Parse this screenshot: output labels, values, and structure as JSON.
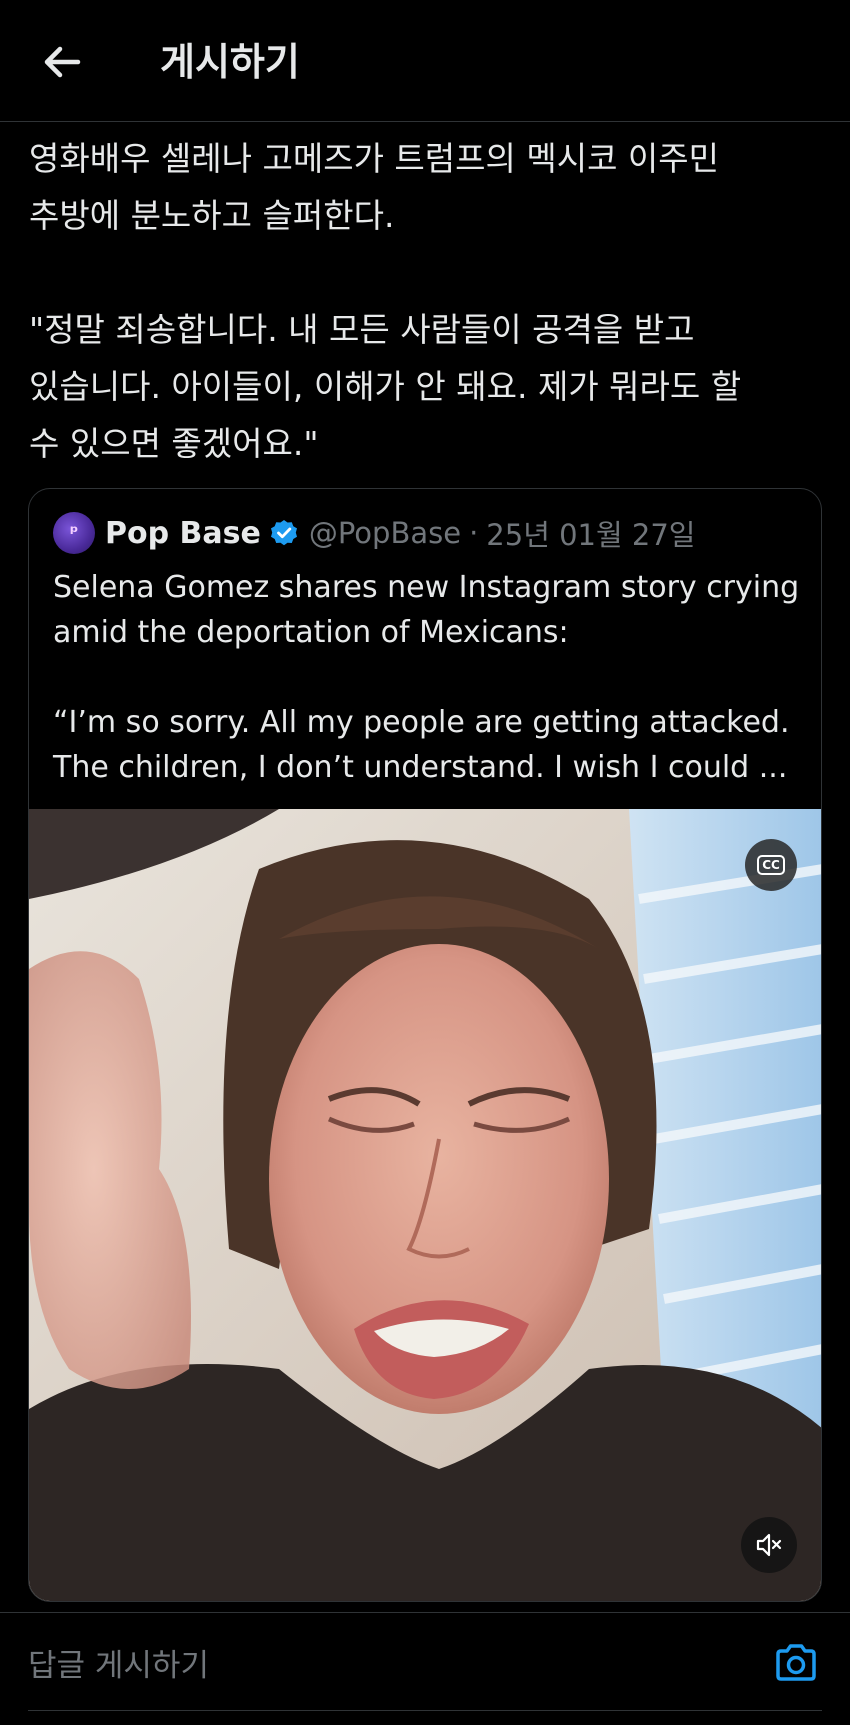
{
  "header": {
    "title": "게시하기",
    "back_icon": "arrow-left-icon"
  },
  "post": {
    "text": "영화배우 셀레나 고메즈가 트럼프의 멕시코 이주민\n추방에 분노하고 슬퍼한다.\n\n\"정말 죄송합니다. 내 모든 사람들이 공격을 받고\n있습니다. 아이들이, 이해가 안 돼요. 제가 뭐라도 할\n수 있으면 좋겠어요.\""
  },
  "quote": {
    "name": "Pop Base",
    "handle": "@PopBase",
    "separator": "·",
    "date": "25년 01월 27일",
    "verified_color": "#1d9bf0",
    "text": "Selena Gomez shares new Instagram story crying\namid the deportation of Mexicans:\n\n“I’m so sorry. All my people are getting attacked.\nThe children, I don’t understand. I wish I could ...",
    "video": {
      "cc_label": "CC",
      "mute_icon": "speaker-muted-icon"
    }
  },
  "reply": {
    "placeholder": "답글 게시하기",
    "camera_icon": "camera-icon",
    "accent_color": "#1d9bf0"
  }
}
